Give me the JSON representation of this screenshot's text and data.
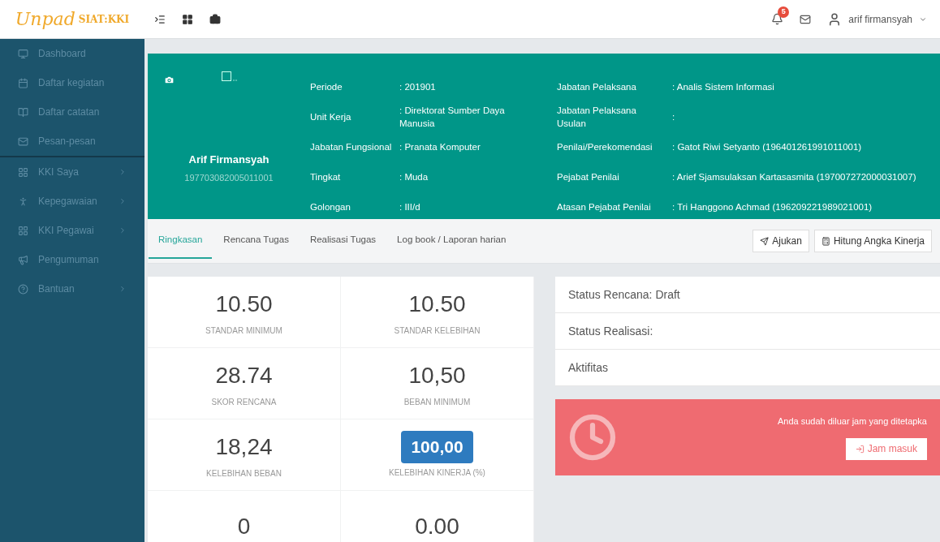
{
  "logo": {
    "wordmark": "Unpad",
    "product": "SIAT:KKI"
  },
  "topbar": {
    "notifications": {
      "count": "5"
    },
    "user": {
      "name": "arif firmansyah"
    }
  },
  "sidebar": {
    "sections": [
      {
        "items": [
          {
            "label": "Dashboard",
            "has_submenu": false,
            "selected": false
          },
          {
            "label": "Daftar kegiatan",
            "has_submenu": false,
            "selected": false
          },
          {
            "label": "Daftar catatan",
            "has_submenu": false,
            "selected": false
          },
          {
            "label": "Pesan-pesan",
            "has_submenu": false,
            "selected": false
          }
        ]
      },
      {
        "items": [
          {
            "label": "KKI Saya",
            "has_submenu": true,
            "selected": false
          },
          {
            "label": "Kepegawaian",
            "has_submenu": true,
            "selected": false
          },
          {
            "label": "KKI Pegawai",
            "has_submenu": true,
            "selected": false
          },
          {
            "label": "Pengumuman",
            "has_submenu": false,
            "selected": false
          },
          {
            "label": "Bantuan",
            "has_submenu": true,
            "selected": false
          }
        ]
      }
    ]
  },
  "profile": {
    "name": "Arif Firmansyah",
    "nip": "197703082005011001",
    "left_fields": [
      {
        "label": "Periode",
        "value": ": 201901"
      },
      {
        "label": "Unit Kerja",
        "value": ": Direktorat Sumber Daya Manusia"
      },
      {
        "label": "Jabatan Fungsional",
        "value": ": Pranata Komputer"
      },
      {
        "label": "Tingkat",
        "value": ": Muda"
      },
      {
        "label": "Golongan",
        "value": ": III/d"
      }
    ],
    "right_fields": [
      {
        "label": "Jabatan Pelaksana",
        "value": ": Analis Sistem Informasi"
      },
      {
        "label": "Jabatan Pelaksana Usulan",
        "value": ":"
      },
      {
        "label": "Penilai/Perekomendasi",
        "value": ": Gatot Riwi Setyanto (196401261991011001)"
      },
      {
        "label": "Pejabat Penilai",
        "value": ": Arief Sjamsulaksan Kartasasmita (197007272000031007)"
      },
      {
        "label": "Atasan Pejabat Penilai",
        "value": ": Tri Hanggono Achmad (196209221989021001)"
      }
    ]
  },
  "tabs": [
    {
      "label": "Ringkasan",
      "selected": true
    },
    {
      "label": "Rencana Tugas",
      "selected": false
    },
    {
      "label": "Realisasi Tugas",
      "selected": false
    },
    {
      "label": "Log book / Laporan harian",
      "selected": false
    }
  ],
  "actions": [
    {
      "label": "Ajukan"
    },
    {
      "label": "Hitung Angka Kinerja"
    }
  ],
  "stats": [
    {
      "value": "10.50",
      "label": "STANDAR MINIMUM",
      "highlighted": false
    },
    {
      "value": "10.50",
      "label": "STANDAR KELEBIHAN",
      "highlighted": false
    },
    {
      "value": "28.74",
      "label": "SKOR RENCANA",
      "highlighted": false
    },
    {
      "value": "10,50",
      "label": "BEBAN MINIMUM",
      "highlighted": false
    },
    {
      "value": "18,24",
      "label": "KELEBIHAN BEBAN",
      "highlighted": false
    },
    {
      "value": "100,00",
      "label": "KELEBIHAN KINERJA (%)",
      "highlighted": true
    },
    {
      "value": "0",
      "highlighted": false
    },
    {
      "value": "0.00",
      "highlighted": false
    }
  ],
  "status_panel": {
    "rows": [
      "Status Rencana: Draft",
      "Status Realisasi:",
      "Aktifitas"
    ]
  },
  "alert": {
    "message": "Anda sudah diluar jam yang ditetapka",
    "button": "Jam masuk"
  }
}
